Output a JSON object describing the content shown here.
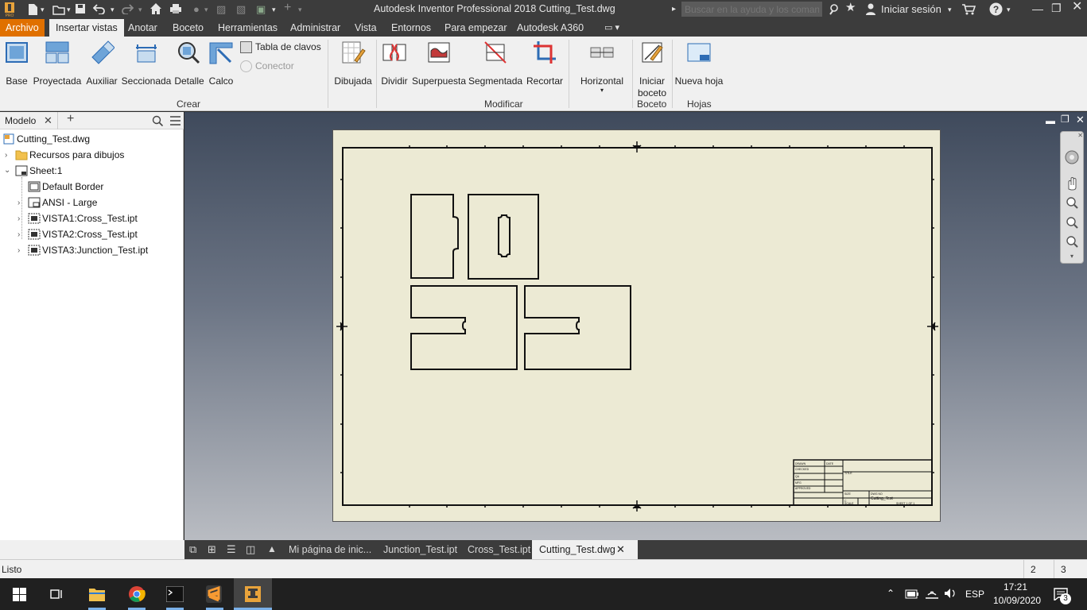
{
  "app": {
    "title": "Autodesk Inventor Professional 2018   Cutting_Test.dwg",
    "help_search_placeholder": "Buscar en la ayuda y los comandos",
    "signin": "Iniciar sesión",
    "icons": [
      "inventor-pro-logo",
      "new-icon",
      "open-icon",
      "save-icon",
      "undo-icon",
      "redo-icon",
      "home-icon",
      "print-icon",
      "search-icon",
      "star-icon",
      "user-icon",
      "cart-icon",
      "help-icon"
    ]
  },
  "menus": [
    "Archivo",
    "Insertar vistas",
    "Anotar",
    "Boceto",
    "Herramientas",
    "Administrar",
    "Vista",
    "Entornos",
    "Para empezar",
    "Autodesk A360"
  ],
  "ribbon": {
    "crear": {
      "label": "Crear",
      "buttons": [
        "Base",
        "Proyectada",
        "Auxiliar",
        "Seccionada",
        "Detalle",
        "Calco"
      ],
      "small": [
        "Tabla de clavos",
        "Conector"
      ]
    },
    "modificar": {
      "label": "Modificar",
      "buttons": [
        "Dibujada",
        "Dividir",
        "Superpuesta",
        "Segmentada",
        "Recortar",
        "Horizontal"
      ]
    },
    "boceto": {
      "label": "Boceto",
      "button": "Iniciar boceto"
    },
    "hojas": {
      "label": "Hojas",
      "button": "Nueva hoja"
    }
  },
  "browser": {
    "tab": "Modelo",
    "items": [
      {
        "label": "Cutting_Test.dwg"
      },
      {
        "label": "Recursos para dibujos"
      },
      {
        "label": "Sheet:1"
      },
      {
        "label": "Default Border"
      },
      {
        "label": "ANSI - Large"
      },
      {
        "label": "VISTA1:Cross_Test.ipt"
      },
      {
        "label": "VISTA2:Cross_Test.ipt"
      },
      {
        "label": "VISTA3:Junction_Test.ipt"
      }
    ]
  },
  "titleblock": {
    "title": "Cutting_Test"
  },
  "doctabs": [
    "Mi página de inic...",
    "Junction_Test.ipt",
    "Cross_Test.ipt",
    "Cutting_Test.dwg"
  ],
  "status": {
    "text": "Listo",
    "num1": "2",
    "num2": "3"
  },
  "taskbar": {
    "lang": "ESP",
    "time": "17:21",
    "date": "10/09/2020",
    "notifications": "3"
  },
  "colors": {
    "accent_orange": "#e07000",
    "sheet": "#ecead4"
  }
}
